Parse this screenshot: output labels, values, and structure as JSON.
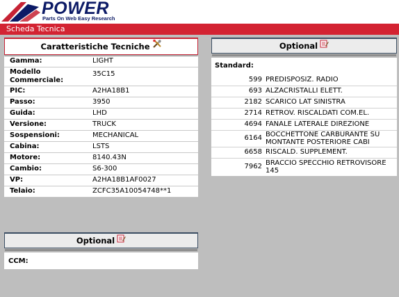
{
  "brand": {
    "name": "POWER",
    "tagline": "Parts On Web Easy Research",
    "colors": {
      "primary": "#0c1a66",
      "accent": "#c62234"
    }
  },
  "titlebar": {
    "label": "Scheda Tecnica"
  },
  "tech": {
    "title": "Caratteristiche Tecniche",
    "icon": "tools-icon",
    "rows": [
      {
        "label": "Gamma:",
        "value": "LIGHT"
      },
      {
        "label": "Modello Commerciale:",
        "value": "35C15"
      },
      {
        "label": "PIC:",
        "value": "A2HA18B1"
      },
      {
        "label": "Passo:",
        "value": "3950"
      },
      {
        "label": "Guida:",
        "value": "LHD"
      },
      {
        "label": "Versione:",
        "value": "TRUCK"
      },
      {
        "label": "Sospensioni:",
        "value": "MECHANICAL"
      },
      {
        "label": "Cabina:",
        "value": "LSTS"
      },
      {
        "label": "Motore:",
        "value": "8140.43N"
      },
      {
        "label": "Cambio:",
        "value": "S6-300"
      },
      {
        "label": "VP:",
        "value": "A2HA18B1AF0027"
      },
      {
        "label": "Telaio:",
        "value": "ZCFC35A10054748**1"
      }
    ]
  },
  "optional_right": {
    "title": "Optional",
    "icon": "notes-icon",
    "standard_label": "Standard:",
    "items": [
      {
        "code": "599",
        "desc": "PREDISPOSIZ. RADIO"
      },
      {
        "code": "693",
        "desc": "ALZACRISTALLI ELETT."
      },
      {
        "code": "2182",
        "desc": "SCARICO LAT SINISTRA"
      },
      {
        "code": "2714",
        "desc": "RETROV. RISCALDATI COM.EL."
      },
      {
        "code": "4694",
        "desc": "FANALE LATERALE DIREZIONE"
      },
      {
        "code": "6164",
        "desc": "BOCCHETTONE CARBURANTE SU MONTANTE POSTERIORE CABI"
      },
      {
        "code": "6658",
        "desc": "RISCALD. SUPPLEMENT."
      },
      {
        "code": "7962",
        "desc": "BRACCIO SPECCHIO RETROVISORE 145"
      }
    ]
  },
  "optional_left": {
    "title": "Optional",
    "icon": "notes-icon",
    "ccm_label": "CCM:"
  }
}
